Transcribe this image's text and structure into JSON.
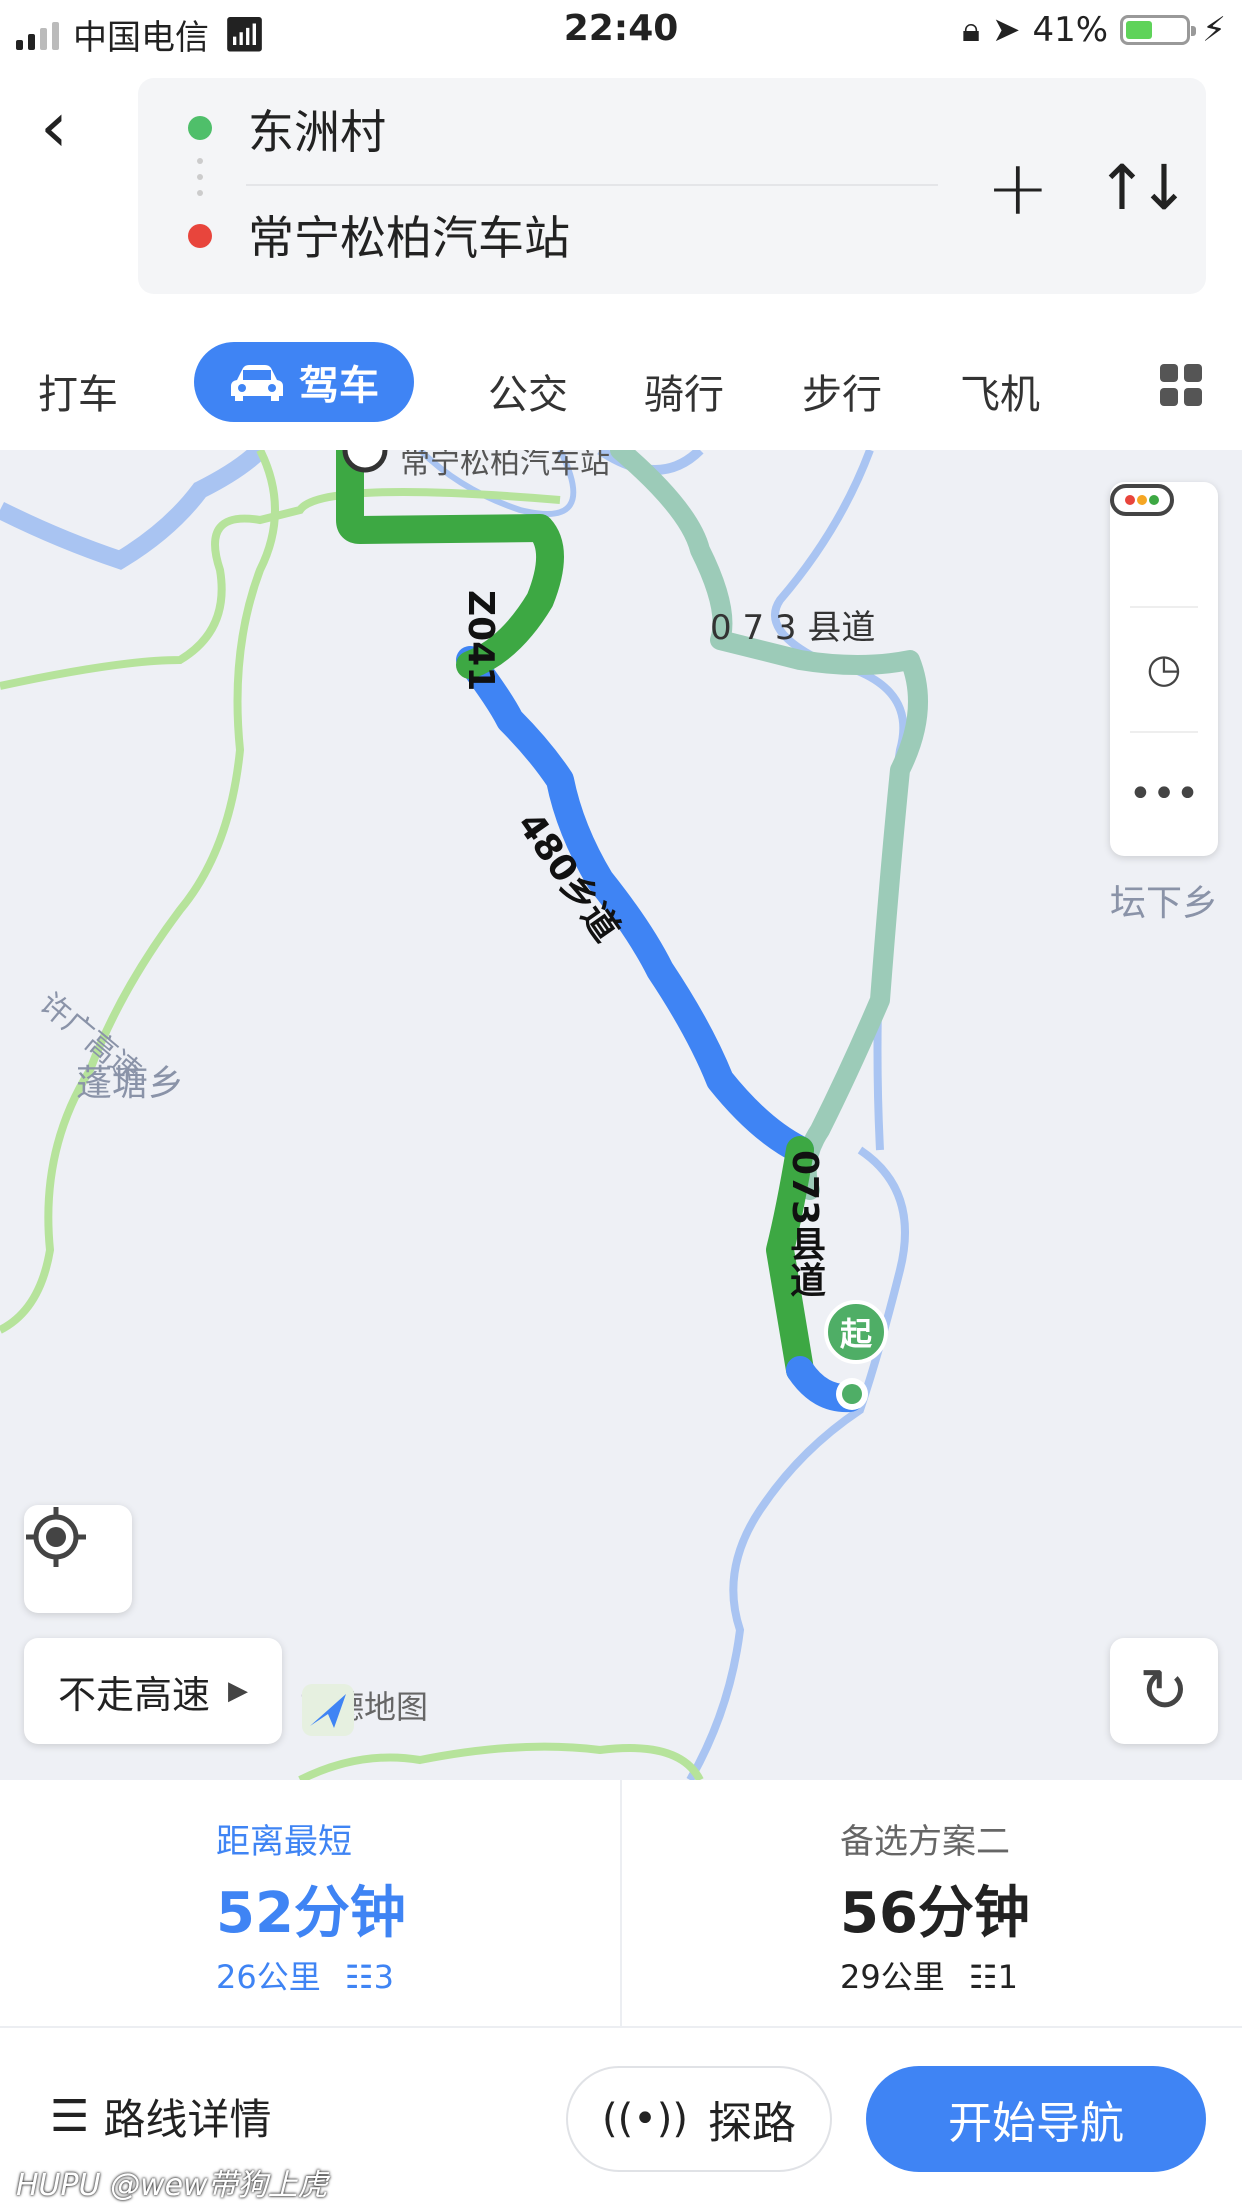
{
  "status_bar": {
    "carrier": "中国电信",
    "time": "22:40",
    "battery": "41%",
    "battery_level": 0.41
  },
  "header": {
    "origin": "东洲村",
    "destination": "常宁松柏汽车站",
    "origin_color": "#4fbf6a",
    "destination_color": "#e8453c"
  },
  "tabs": {
    "items": [
      "打车",
      "驾车",
      "公交",
      "骑行",
      "步行",
      "飞机"
    ],
    "active": "驾车"
  },
  "map": {
    "labels": {
      "road_073_top": "0 7 3 县道",
      "road_z041": "Z041",
      "road_480": "480乡道",
      "road_073_right": "073县道",
      "town_1": "坛下乡",
      "town_2": "蓬塘乡",
      "expressway": "许广高速",
      "dest_label": "常宁松柏汽车站"
    },
    "start_marker": "起",
    "avoid_highway": "不走高速",
    "logo": "高德地图",
    "route_colors": {
      "primary": "#3f84f4",
      "congested": "#3da843",
      "alternate": "#9ccbb8"
    }
  },
  "options": [
    {
      "tag": "距离最短",
      "time": "52分钟",
      "distance": "26公里",
      "lights": "3",
      "active": true
    },
    {
      "tag": "备选方案二",
      "time": "56分钟",
      "distance": "29公里",
      "lights": "1",
      "active": false
    }
  ],
  "bottom": {
    "details": "路线详情",
    "explore": "探路",
    "navigate": "开始导航"
  },
  "watermark": "HUPU @wew带狗上虎"
}
